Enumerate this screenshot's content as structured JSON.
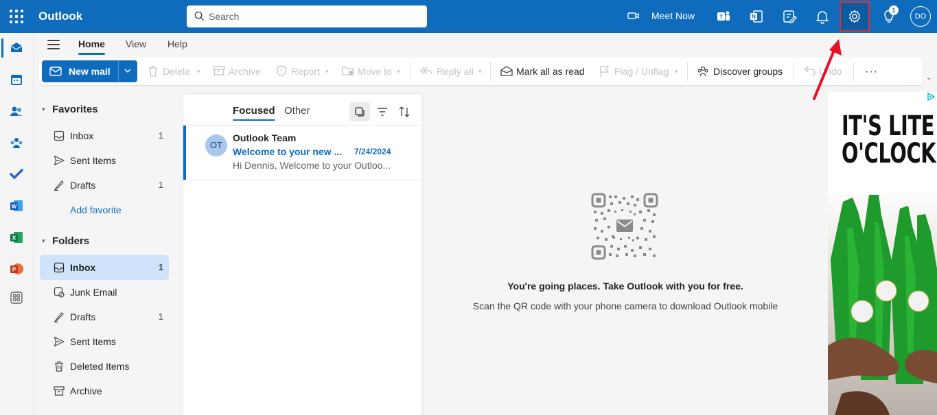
{
  "app": {
    "title": "Outlook"
  },
  "header": {
    "search_placeholder": "Search",
    "meet_now_label": "Meet Now",
    "notification_badge": "1",
    "avatar_initials": "DO",
    "highlight_color": "#d13438",
    "brand_color": "#0f6cbd"
  },
  "app_rail": {
    "items": [
      "mail-icon",
      "calendar-icon",
      "people-icon",
      "groups-icon",
      "todo-icon",
      "word-icon",
      "excel-icon",
      "powerpoint-icon",
      "more-apps-icon"
    ]
  },
  "ribbon": {
    "tabs": [
      "Home",
      "View",
      "Help"
    ],
    "active_tab": "Home",
    "new_mail": "New mail",
    "delete": "Delete",
    "archive": "Archive",
    "report": "Report",
    "move_to": "Move to",
    "reply_all": "Reply all",
    "mark_all_read": "Mark all as read",
    "flag_unflag": "Flag / Unflag",
    "discover_groups": "Discover groups",
    "undo": "Undo",
    "more": "···"
  },
  "folder_pane": {
    "favorites_title": "Favorites",
    "favorites": [
      {
        "label": "Inbox",
        "count": "1"
      },
      {
        "label": "Sent Items",
        "count": ""
      },
      {
        "label": "Drafts",
        "count": "1"
      }
    ],
    "add_favorite": "Add favorite",
    "folders_title": "Folders",
    "folders": [
      {
        "label": "Inbox",
        "count": "1",
        "selected": true
      },
      {
        "label": "Junk Email",
        "count": ""
      },
      {
        "label": "Drafts",
        "count": "1"
      },
      {
        "label": "Sent Items",
        "count": ""
      },
      {
        "label": "Deleted Items",
        "count": ""
      },
      {
        "label": "Archive",
        "count": ""
      }
    ]
  },
  "message_list": {
    "tabs": [
      "Focused",
      "Other"
    ],
    "active_tab": "Focused",
    "messages": [
      {
        "avatar": "OT",
        "sender": "Outlook Team",
        "subject": "Welcome to your new ...",
        "date": "7/24/2024",
        "preview": "Hi Dennis, Welcome to your Outloo..."
      }
    ]
  },
  "reading_pane": {
    "headline": "You're going places. Take Outlook with you for free.",
    "subtext": "Scan the QR code with your phone camera to download Outlook mobile"
  },
  "ad": {
    "headline_line1": "IT'S LITE",
    "headline_line2": "O'CLOCK"
  }
}
